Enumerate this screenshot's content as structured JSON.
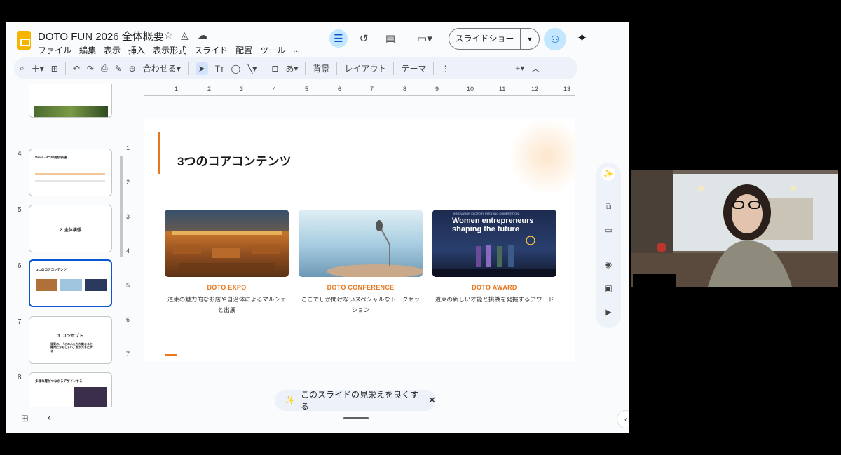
{
  "header": {
    "title": "DOTO FUN 2026 全体概要",
    "menu": [
      "ファイル",
      "編集",
      "表示",
      "挿入",
      "表示形式",
      "スライド",
      "配置",
      "ツール",
      "..."
    ],
    "slideshow_label": "スライドショー"
  },
  "toolbar": {
    "zoom_label": "合わせる",
    "background_label": "背景",
    "layout_label": "レイアウト",
    "theme_label": "テーマ",
    "font_label": "あ"
  },
  "filmstrip": {
    "slides": [
      {
        "num": "4",
        "title": "Value - 4つの提供価値"
      },
      {
        "num": "5",
        "title": "2. 全体構想"
      },
      {
        "num": "6",
        "title": "3つのコアコンテンツ"
      },
      {
        "num": "7",
        "title": "3. コンセプト",
        "sub": "道東の、「この人たちが集まると絶対におもしろい」をかたちにする"
      },
      {
        "num": "8",
        "title": "多様な層がつながるデザインする"
      }
    ]
  },
  "ruler": {
    "h": [
      "1",
      "2",
      "3",
      "4",
      "5",
      "6",
      "7",
      "8",
      "9",
      "10",
      "11",
      "12",
      "13"
    ],
    "v": [
      "1",
      "2",
      "3",
      "4",
      "5",
      "6",
      "7"
    ]
  },
  "slide": {
    "heading": "3つのコアコンテンツ",
    "cards": [
      {
        "title": "DOTO EXPO",
        "desc": "道東の魅力的なお店や自治体によるマルシェと出展"
      },
      {
        "title": "DOTO CONFERENCE",
        "desc": "ここでしか聞けないスペシャルなトークセッション"
      },
      {
        "title": "DOTO AWARD",
        "desc": "道東の新しい才能と挑戦を発掘するアワード",
        "image_caption_small": "INNOVATION FACTORY PITCHING COMPETITION",
        "image_caption": "Women entrepreneurs shaping the future"
      }
    ]
  },
  "bottom": {
    "beautify_label": "このスライドの見栄えを良くする"
  },
  "colors": {
    "accent": "#e8771e",
    "selected": "#0b57d0",
    "logo": "#f4b400"
  }
}
